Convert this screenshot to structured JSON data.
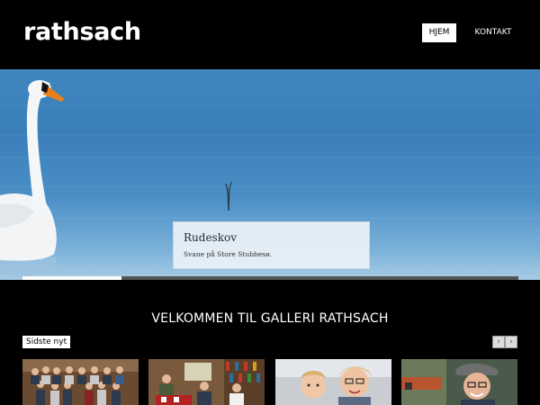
{
  "header": {
    "logo": "rathsach",
    "nav": [
      {
        "label": "HJEM",
        "active": true
      },
      {
        "label": "KONTAKT",
        "active": false
      }
    ]
  },
  "hero": {
    "caption_title": "Rudeskov",
    "caption_text": "Svane på Store Stubbesø.",
    "slide_progress": 0.2
  },
  "main": {
    "welcome_title": "VELKOMMEN TIL GALLERI RATHSACH",
    "latest_label": "Sidste nyt",
    "prev_arrow": "‹",
    "next_arrow": "›"
  },
  "colors": {
    "background": "#000000",
    "water": "#3f86bf",
    "caption_bg": "#e9f0f6"
  }
}
